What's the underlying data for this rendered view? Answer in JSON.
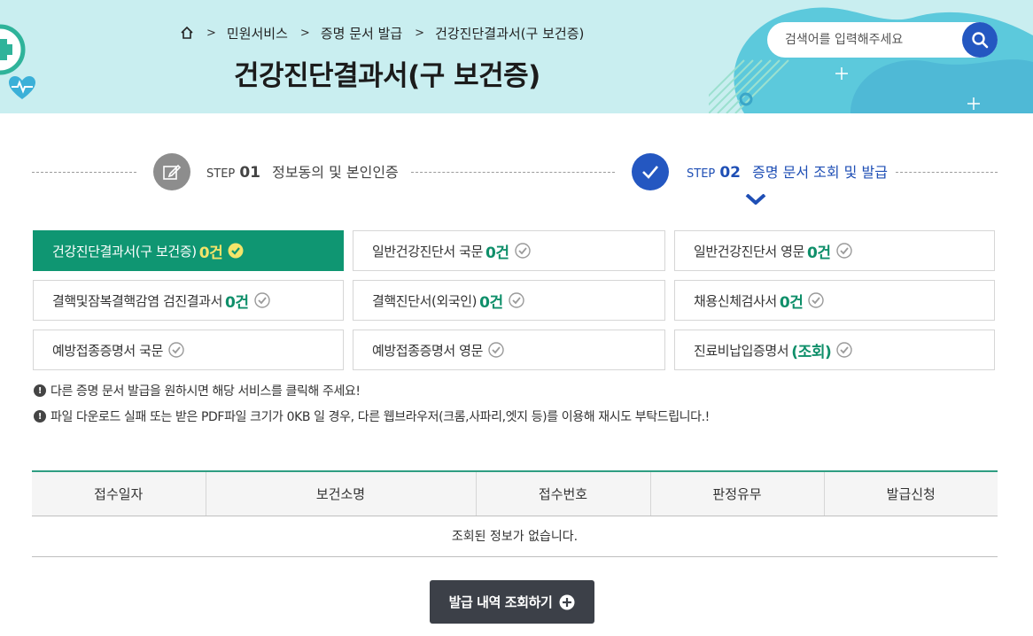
{
  "header": {
    "breadcrumb": [
      "민원서비스",
      "증명 문서 발급",
      "건강진단결과서(구 보건증)"
    ],
    "title": "건강진단결과서(구 보건증)",
    "search_placeholder": "검색어를 입력해주세요"
  },
  "steps": [
    {
      "label": "STEP",
      "num": "01",
      "text": "정보동의 및 본인인증",
      "state": "done"
    },
    {
      "label": "STEP",
      "num": "02",
      "text": "증명 문서 조회 및 발급",
      "state": "current"
    }
  ],
  "documents": [
    {
      "name": "건강진단결과서(구 보건증)",
      "count": "0건",
      "active": true
    },
    {
      "name": "일반건강진단서 국문",
      "count": "0건"
    },
    {
      "name": "일반건강진단서 영문",
      "count": "0건"
    },
    {
      "name": "결핵및잠복결핵감염 검진결과서",
      "count": "0건"
    },
    {
      "name": "결핵진단서(외국인)",
      "count": "0건"
    },
    {
      "name": "채용신체검사서",
      "count": "0건"
    },
    {
      "name": "예방접종증명서 국문",
      "count": ""
    },
    {
      "name": "예방접종증명서 영문",
      "count": ""
    },
    {
      "name": "진료비납입증명서",
      "count": "(조회)"
    }
  ],
  "notices": [
    "다른 증명 문서 발급을 원하시면 해당 서비스를 클릭해 주세요!",
    "파일 다운로드 실패 또는 받은 PDF파일 크기가 0KB 일 경우, 다른 웹브라우저(크롬,사파리,엣지 등)를 이용해 재시도 부탁드립니다.!"
  ],
  "table": {
    "columns": [
      "접수일자",
      "보건소명",
      "접수번호",
      "판정유무",
      "발급신청"
    ],
    "empty_message": "조회된 정보가 없습니다."
  },
  "view_button": "발급 내역 조회하기",
  "colors": {
    "accent_green": "#0f9672",
    "step_blue": "#1f4fb5",
    "banner": "#c9eef0"
  }
}
